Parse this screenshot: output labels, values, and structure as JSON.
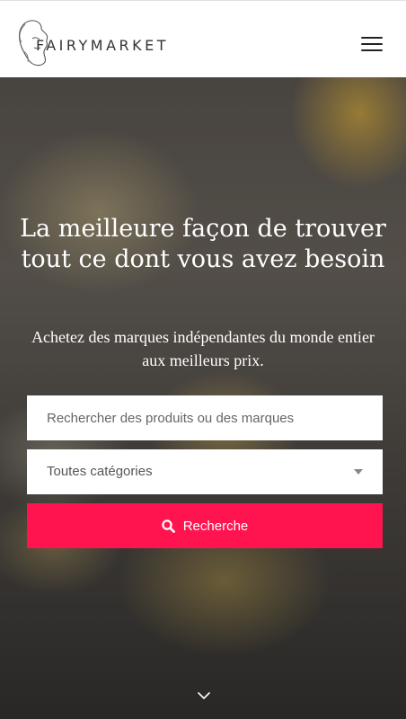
{
  "header": {
    "brand": "FAIRYMARKET",
    "logo_icon": "fairy-face-line-art",
    "menu_icon": "hamburger-menu-icon"
  },
  "hero": {
    "headline": "La meilleure façon de trouver tout ce dont vous avez besoin",
    "subline": "Achetez des marques indépendantes du monde entier aux meilleurs prix.",
    "search": {
      "placeholder": "Rechercher des produits ou des marques",
      "value": ""
    },
    "category": {
      "selected": "Toutes catégories"
    },
    "search_button": {
      "label": "Recherche",
      "icon": "search-icon"
    },
    "scroll_icon": "chevron-down-icon"
  },
  "colors": {
    "accent": "#ff1450",
    "header_bg": "#ffffff",
    "text_light": "#ffffff"
  }
}
